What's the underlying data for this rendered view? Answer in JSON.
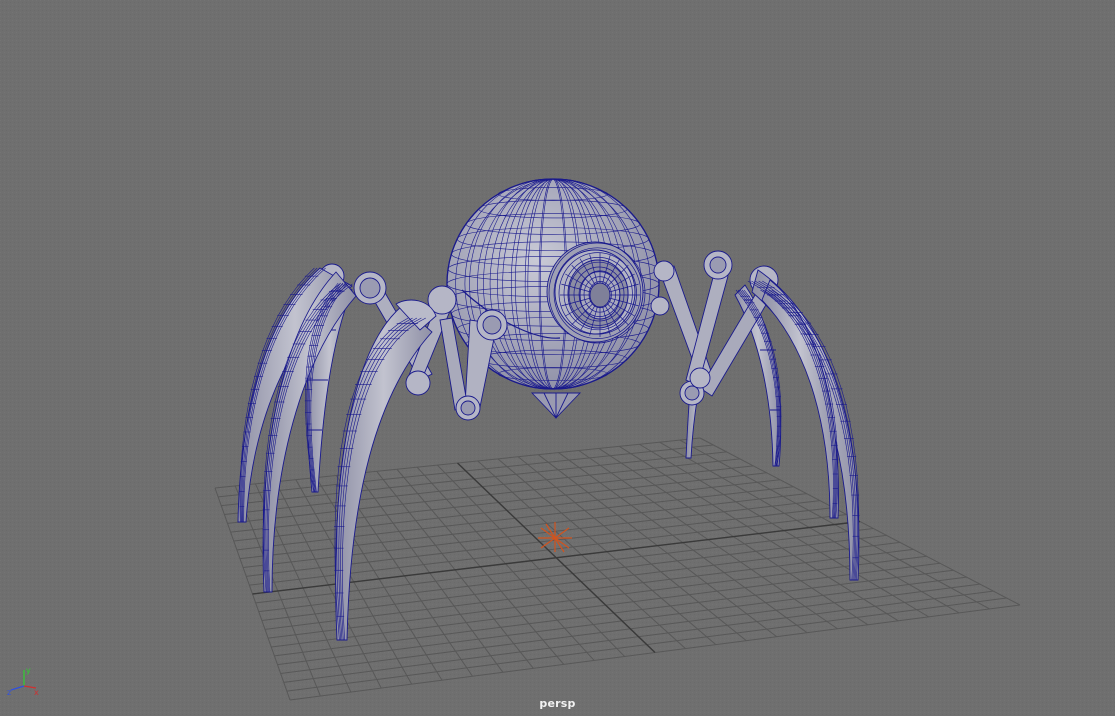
{
  "viewport": {
    "camera_label": "persp",
    "background_color": "#6f6f6f",
    "grid_color": "#5a5a5a",
    "wireframe_color": "#1a1a8c",
    "surface_color": "#a6a7b8",
    "pivot_color": "#d2531d"
  },
  "axis_gizmo": {
    "x_label": "x",
    "y_label": "y",
    "z_label": "z",
    "x_color": "#d03030",
    "y_color": "#2fd02f",
    "z_color": "#3050e0"
  }
}
